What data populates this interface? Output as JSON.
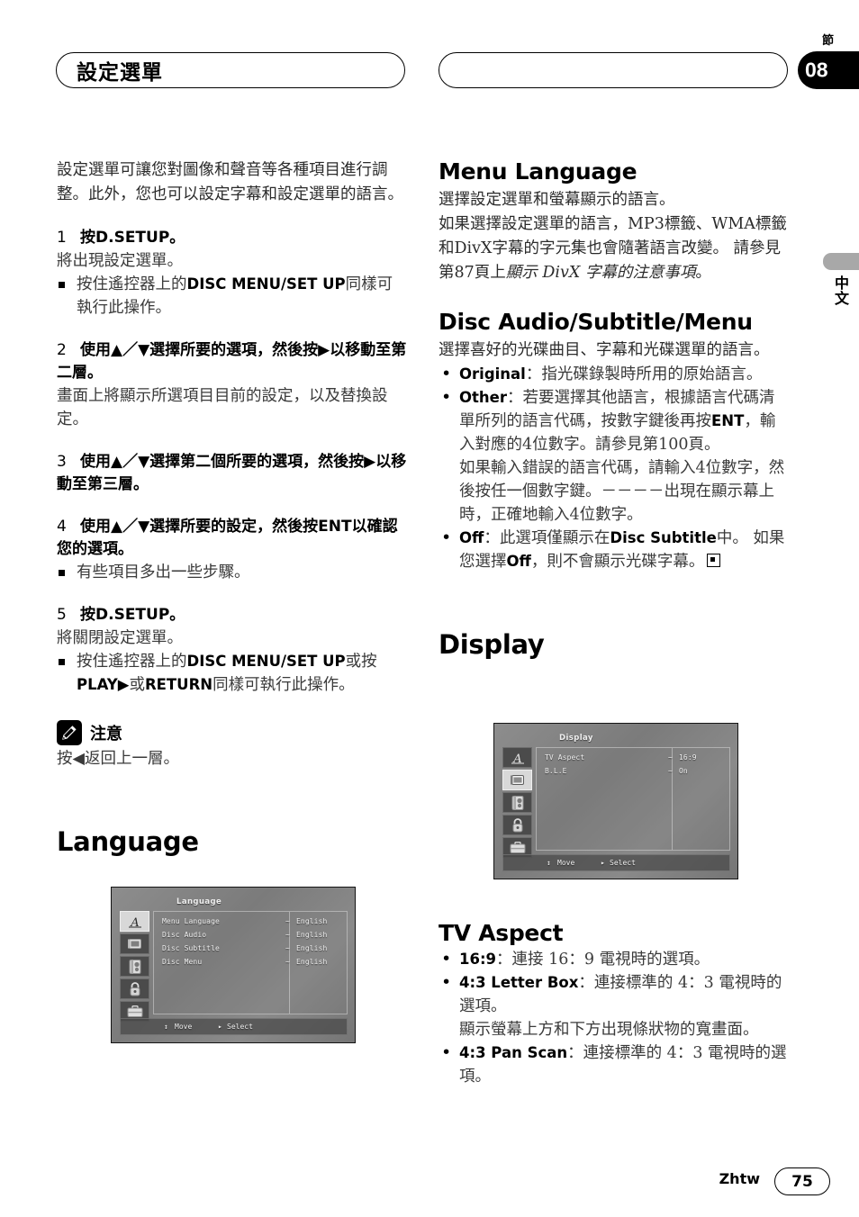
{
  "header": {
    "section_title": "設定選單",
    "chapter_label": "節",
    "chapter_number": "08"
  },
  "side_tab": {
    "language": "中文"
  },
  "left_column": {
    "intro": "設定選單可讓您對圖像和聲音等各種項目進行調整。此外，您也可以設定字幕和設定選單的語言。",
    "steps": [
      {
        "number": "1",
        "heading": "按D.SETUP。",
        "body": "將出現設定選單。",
        "notes_pre": "按住遙控器上的",
        "notes_key": "DISC MENU/SET UP",
        "notes_post": "同樣可執行此操作。"
      },
      {
        "number": "2",
        "heading": "使用▲／▼選擇所要的選項，然後按▶以移動至第二層。",
        "body": "畫面上將顯示所選項目目前的設定，以及替換設定。"
      },
      {
        "number": "3",
        "heading": "使用▲／▼選擇第二個所要的選項，然後按▶以移動至第三層。",
        "body": ""
      },
      {
        "number": "4",
        "heading": "使用▲／▼選擇所要的設定，然後按ENT以確認您的選項。",
        "body": "",
        "note": "有些項目多出一些步驟。"
      },
      {
        "number": "5",
        "heading": "按D.SETUP。",
        "body": "將關閉設定選單。",
        "notes_pre": "按住遙控器上的",
        "notes_key": "DISC MENU/SET UP",
        "notes_mid": "或按",
        "notes_key2": "PLAY▶",
        "notes_mid2": "或",
        "notes_key3": "RETURN",
        "notes_post": "同樣可執行此操作。"
      }
    ],
    "note": {
      "icon": "pencil-icon",
      "title": "注意",
      "body": "按◀返回上一層。"
    },
    "language_heading": "Language"
  },
  "right_column": {
    "menu_language": {
      "heading": "Menu Language",
      "line1": "選擇設定選單和螢幕顯示的語言。",
      "line2": "如果選擇設定選單的語言，MP3標籤、WMA標籤和DivX字幕的字元集也會隨著語言改變。 請參見第87頁上",
      "ref_italic": "顯示 DivX 字幕的注意事項",
      "line3": "。"
    },
    "disc_audio": {
      "heading": "Disc Audio/Subtitle/Menu",
      "intro": "選擇喜好的光碟曲目、字幕和光碟選單的語言。",
      "bullets": [
        {
          "term": "Original",
          "sep": "：",
          "text": "指光碟錄製時所用的原始語言。"
        },
        {
          "term": "Other",
          "sep": "：",
          "text": "若要選擇其他語言，根據語言代碼清單所列的語言代碼，按數字鍵後再按",
          "bold_key": "ENT",
          "text2": "，輸入對應的4位數字。請參見第100頁。",
          "extra": "如果輸入錯誤的語言代碼，請輸入4位數字，然後按任一個數字鍵。－－－－出現在顯示幕上時，正確地輸入4位數字。"
        },
        {
          "term": "Off",
          "sep": "：",
          "text": "此選項僅顯示在",
          "bold_key": "Disc Subtitle",
          "text2": "中。 如果您選擇",
          "bold_key2": "Off",
          "text3": "，則不會顯示光碟字幕。"
        }
      ]
    },
    "display_heading": "Display",
    "tv_aspect": {
      "heading": "TV Aspect",
      "bullets": [
        {
          "term": "16:9",
          "sep": "：",
          "text": "連接 16：9 電視時的選項。"
        },
        {
          "term": "4:3 Letter Box",
          "sep": "：",
          "text": "連接標準的 4：3 電視時的選項。",
          "extra": "顯示螢幕上方和下方出現條狀物的寬畫面。"
        },
        {
          "term": "4:3 Pan Scan",
          "sep": "：",
          "text": "連接標準的 4：3 電視時的選項。"
        }
      ]
    }
  },
  "osd_language": {
    "title": "Language",
    "icons": [
      "language-icon",
      "display-icon",
      "audio-icon",
      "lock-icon",
      "others-icon"
    ],
    "selected_icon_index": 0,
    "rows": [
      {
        "label": "Menu Language",
        "value": "English"
      },
      {
        "label": "Disc Audio",
        "value": "English"
      },
      {
        "label": "Disc Subtitle",
        "value": "English"
      },
      {
        "label": "Disc Menu",
        "value": "English"
      }
    ],
    "footer": {
      "move_glyph": "↕",
      "move": "Move",
      "select_glyph": "▸",
      "select": "Select"
    }
  },
  "osd_display": {
    "title": "Display",
    "icons": [
      "language-icon",
      "display-icon",
      "audio-icon",
      "lock-icon",
      "others-icon"
    ],
    "selected_icon_index": 1,
    "rows": [
      {
        "label": "TV Aspect",
        "value": "16:9"
      },
      {
        "label": "B.L.E",
        "value": "On"
      }
    ],
    "footer": {
      "move_glyph": "↕",
      "move": "Move",
      "select_glyph": "▸",
      "select": "Select"
    }
  },
  "footer": {
    "language_code": "Zhtw",
    "page_number": "75"
  }
}
